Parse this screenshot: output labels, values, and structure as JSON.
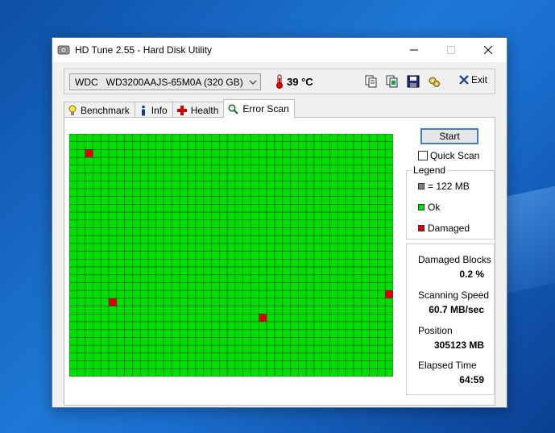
{
  "window": {
    "title": "HD Tune 2.55 - Hard Disk Utility",
    "app_icon": "hard-disk-icon",
    "buttons": [
      "minimize",
      "maximize",
      "close"
    ]
  },
  "toolbar": {
    "drive_brand": "WDC",
    "drive_model": "WD3200AAJS-65M0A (320 GB)",
    "temperature": "39 °C",
    "icons": [
      "copy-text-icon",
      "copy-screenshot-icon",
      "save-icon",
      "options-icon"
    ],
    "exit_label": "Exit"
  },
  "tabs": [
    {
      "label": "Benchmark",
      "icon": "lightbulb-icon",
      "active": false
    },
    {
      "label": "Info",
      "icon": "info-icon",
      "active": false
    },
    {
      "label": "Health",
      "icon": "health-cross-icon",
      "active": false
    },
    {
      "label": "Error Scan",
      "icon": "magnifier-icon",
      "active": true
    }
  ],
  "error_scan": {
    "start_label": "Start",
    "quick_scan_label": "Quick Scan",
    "quick_scan_checked": false,
    "grid": {
      "columns": 41,
      "rows": 31,
      "damaged_cells": [
        [
          2,
          2
        ],
        [
          5,
          21
        ],
        [
          24,
          23
        ],
        [
          40,
          20
        ]
      ]
    },
    "legend": {
      "title": "Legend",
      "block_size": "= 122 MB",
      "ok_label": "Ok",
      "damaged_label": "Damaged"
    },
    "stats": {
      "damaged_blocks_label": "Damaged Blocks",
      "damaged_blocks_value": "0.2 %",
      "scanning_speed_label": "Scanning Speed",
      "scanning_speed_value": "60.7 MB/sec",
      "position_label": "Position",
      "position_value": "305123 MB",
      "elapsed_time_label": "Elapsed Time",
      "elapsed_time_value": "64:59"
    }
  },
  "colors": {
    "ok": "#00e000",
    "damaged": "#e00000",
    "grid_line": "#1a5a1a",
    "block": "#808080"
  }
}
